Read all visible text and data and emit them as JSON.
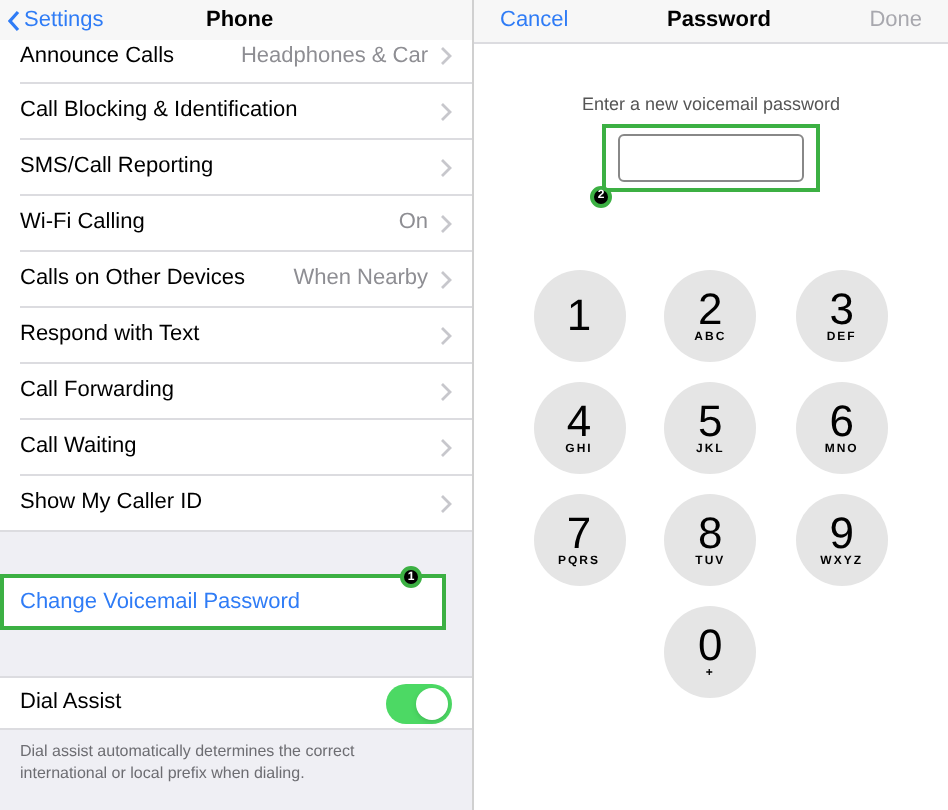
{
  "settings_panel": {
    "nav_bar": {
      "back": "Settings",
      "title": "Phone"
    },
    "rows": [
      {
        "label": "Announce Calls",
        "value": "Headphones & Car"
      },
      {
        "label": "Call Blocking & Identification"
      },
      {
        "label": "SMS/Call Reporting"
      },
      {
        "label": "Wi-Fi Calling",
        "value": "On"
      },
      {
        "label": "Calls on Other Devices",
        "value": "When Nearby"
      },
      {
        "label": "Respond with Text"
      },
      {
        "label": "Call Forwarding"
      },
      {
        "label": "Call Waiting"
      },
      {
        "label": "Show My Caller ID"
      }
    ],
    "action": {
      "label": "Change Voicemail Password",
      "annotation": "1"
    },
    "toggle": {
      "label": "Dial Assist",
      "on": true
    },
    "footer": "Dial assist automatically determines the correct international or local prefix when dialing."
  },
  "password_panel": {
    "nav_bar": {
      "cancel": "Cancel",
      "title": "Password",
      "done": "Done",
      "done_disabled": true
    },
    "prompt": "Enter a new voicemail password",
    "annotation": "2",
    "keypad": [
      {
        "digit": "1"
      },
      {
        "digit": "2",
        "letters": "ABC"
      },
      {
        "digit": "3",
        "letters": "DEF"
      },
      {
        "digit": "4",
        "letters": "GHI"
      },
      {
        "digit": "5",
        "letters": "JKL"
      },
      {
        "digit": "6",
        "letters": "MNO"
      },
      {
        "digit": "7",
        "letters": "PQRS"
      },
      {
        "digit": "8",
        "letters": "TUV"
      },
      {
        "digit": "9",
        "letters": "WXYZ"
      },
      {
        "digit": "0",
        "letters": "+"
      }
    ]
  }
}
